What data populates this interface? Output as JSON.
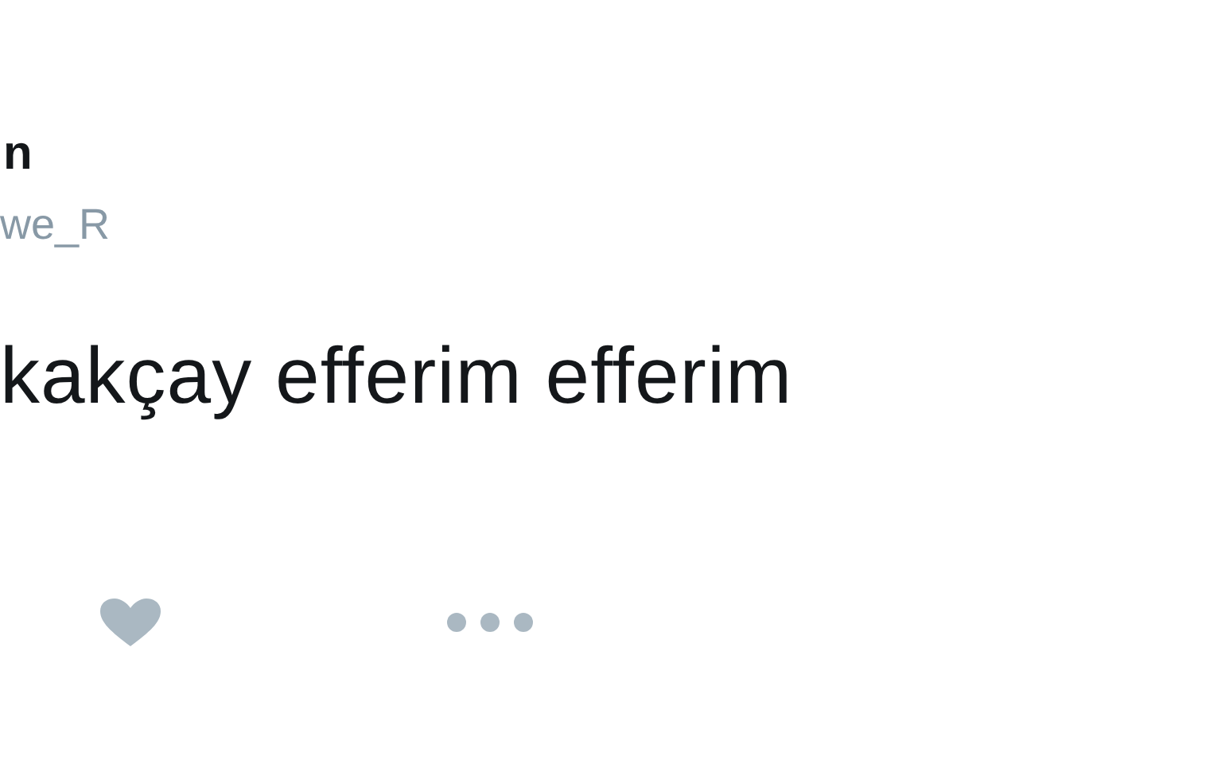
{
  "author": {
    "name": "n",
    "handle": "we_R"
  },
  "tweet": {
    "text": "kakçay efferim efferim"
  },
  "actions": [
    {
      "kind": "like"
    },
    {
      "kind": "more"
    }
  ]
}
